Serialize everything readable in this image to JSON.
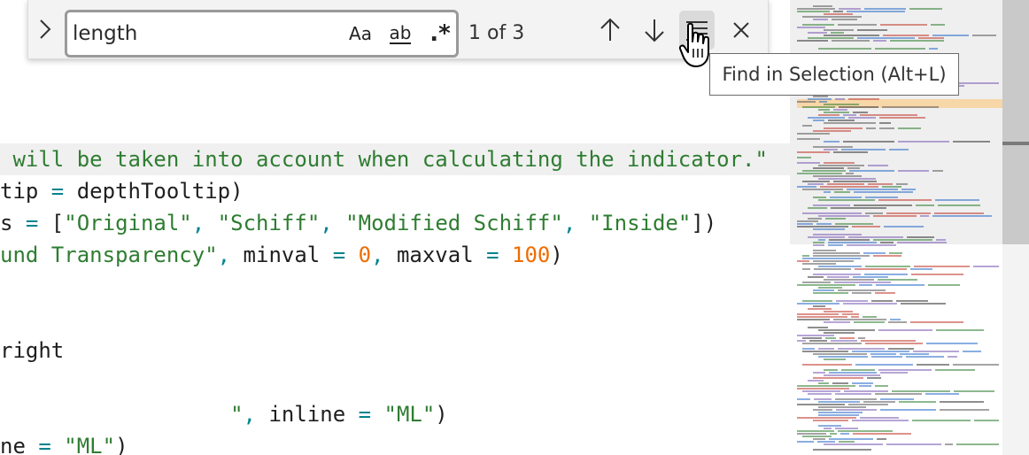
{
  "find": {
    "query": "length",
    "match_case_label": "Aa",
    "whole_word_label": "ab",
    "regex_label": ".*",
    "match_count": "1 of 3",
    "tooltip": "Find in Selection (Alt+L)"
  },
  "code_lines": [
    [
      {
        "text": " will be taken into account when calculating the indicator.\"",
        "kind": "str"
      }
    ],
    [
      {
        "text": "tip ",
        "kind": "id"
      },
      {
        "text": "=",
        "kind": "op"
      },
      {
        "text": " depthTooltip)",
        "kind": "id"
      }
    ],
    [
      {
        "text": "s ",
        "kind": "id"
      },
      {
        "text": "=",
        "kind": "op"
      },
      {
        "text": " [",
        "kind": "id"
      },
      {
        "text": "\"Original\"",
        "kind": "str"
      },
      {
        "text": ",",
        "kind": "op"
      },
      {
        "text": " ",
        "kind": "id"
      },
      {
        "text": "\"Schiff\"",
        "kind": "str"
      },
      {
        "text": ",",
        "kind": "op"
      },
      {
        "text": " ",
        "kind": "id"
      },
      {
        "text": "\"Modified Schiff\"",
        "kind": "str"
      },
      {
        "text": ",",
        "kind": "op"
      },
      {
        "text": " ",
        "kind": "id"
      },
      {
        "text": "\"Inside\"",
        "kind": "str"
      },
      {
        "text": "])",
        "kind": "id"
      }
    ],
    [
      {
        "text": "und Transparency\"",
        "kind": "str"
      },
      {
        "text": ",",
        "kind": "op"
      },
      {
        "text": " minval ",
        "kind": "id"
      },
      {
        "text": "=",
        "kind": "op"
      },
      {
        "text": " ",
        "kind": "id"
      },
      {
        "text": "0",
        "kind": "num"
      },
      {
        "text": ",",
        "kind": "op"
      },
      {
        "text": " maxval ",
        "kind": "id"
      },
      {
        "text": "=",
        "kind": "op"
      },
      {
        "text": " ",
        "kind": "id"
      },
      {
        "text": "100",
        "kind": "num"
      },
      {
        "text": ")",
        "kind": "id"
      }
    ],
    [],
    [],
    [
      {
        "text": "right",
        "kind": "id"
      }
    ],
    [],
    [
      {
        "text": "                  ",
        "kind": "id"
      },
      {
        "text": "\"",
        "kind": "str"
      },
      {
        "text": ",",
        "kind": "op"
      },
      {
        "text": " inline ",
        "kind": "id"
      },
      {
        "text": "=",
        "kind": "op"
      },
      {
        "text": " ",
        "kind": "id"
      },
      {
        "text": "\"ML\"",
        "kind": "str"
      },
      {
        "text": ")",
        "kind": "id"
      }
    ],
    [
      {
        "text": "ne ",
        "kind": "id"
      },
      {
        "text": "=",
        "kind": "op"
      },
      {
        "text": " ",
        "kind": "id"
      },
      {
        "text": "\"ML\"",
        "kind": "str"
      },
      {
        "text": ")",
        "kind": "id"
      }
    ]
  ],
  "colors": {
    "string": "#2f7d32",
    "operator": "#00838f",
    "number": "#ef6c00",
    "identifier": "#1f1f1f",
    "minimap_highlight": "#f7d6a8"
  },
  "icons": {
    "toggle_replace": "chevron-right-icon",
    "previous_match": "arrow-up-icon",
    "next_match": "arrow-down-icon",
    "find_in_selection": "find-in-selection-icon",
    "close": "close-icon",
    "cursor": "hand-pointer-icon"
  }
}
